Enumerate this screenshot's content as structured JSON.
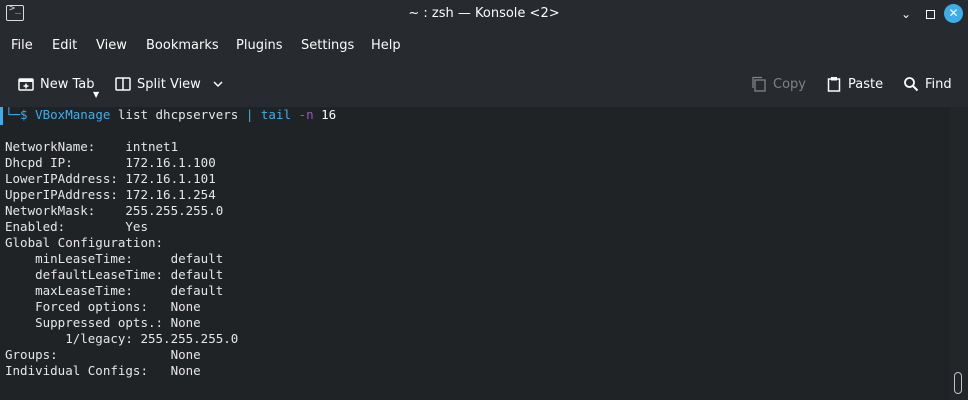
{
  "window": {
    "title": "~ : zsh — Konsole <2>",
    "app_icon_glyph": ">_",
    "minimize": "⌄",
    "close": "✕"
  },
  "menubar": {
    "items": [
      "File",
      "Edit",
      "View",
      "Bookmarks",
      "Plugins",
      "Settings",
      "Help"
    ]
  },
  "toolbar": {
    "new_tab": "New Tab",
    "split_view": "Split View",
    "copy": "Copy",
    "paste": "Paste",
    "find": "Find"
  },
  "terminal": {
    "prompt_prefix": "└─$",
    "command": "VBoxManage list dhcpservers",
    "pipe": "|",
    "tail": "tail",
    "flag": "-n",
    "arg": "16",
    "output": [
      "",
      "NetworkName:    intnet1",
      "Dhcpd IP:       172.16.1.100",
      "LowerIPAddress: 172.16.1.101",
      "UpperIPAddress: 172.16.1.254",
      "NetworkMask:    255.255.255.0",
      "Enabled:        Yes",
      "Global Configuration:",
      "    minLeaseTime:     default",
      "    defaultLeaseTime: default",
      "    maxLeaseTime:     default",
      "    Forced options:   None",
      "    Suppressed opts.: None",
      "        1/legacy: 255.255.255.0",
      "Groups:               None",
      "Individual Configs:   None"
    ]
  },
  "colors": {
    "accent": "#3daee9",
    "background": "#202326",
    "chrome": "#272a2e",
    "flag": "#9b59b6"
  }
}
